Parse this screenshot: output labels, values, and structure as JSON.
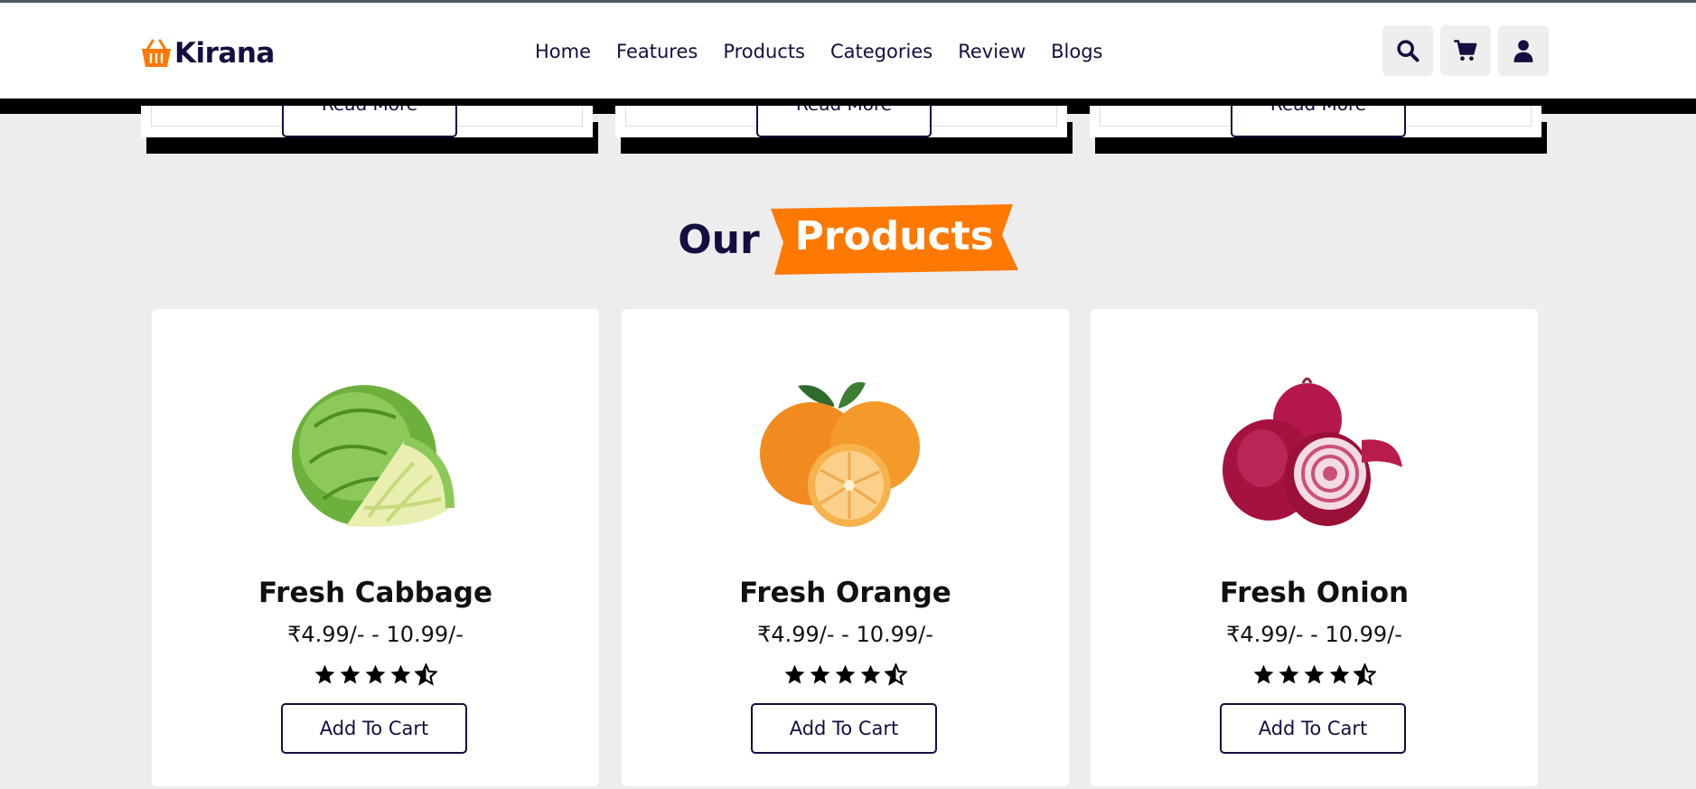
{
  "brand": {
    "name": "Kirana",
    "accent": "#ff7800",
    "dark": "#130f40"
  },
  "nav": {
    "items": [
      "Home",
      "Features",
      "Products",
      "Categories",
      "Review",
      "Blogs"
    ]
  },
  "header_icons": [
    "search-icon",
    "cart-icon",
    "user-icon"
  ],
  "blogs": {
    "read_more_label": "Read More"
  },
  "section": {
    "title_dark": "Our",
    "title_highlight": "Products"
  },
  "products": [
    {
      "name": "Fresh Cabbage",
      "price": "₹4.99/- - 10.99/-",
      "rating": 4.5,
      "button": "Add To Cart"
    },
    {
      "name": "Fresh Orange",
      "price": "₹4.99/- - 10.99/-",
      "rating": 4.5,
      "button": "Add To Cart"
    },
    {
      "name": "Fresh Onion",
      "price": "₹4.99/- - 10.99/-",
      "rating": 4.5,
      "button": "Add To Cart"
    }
  ]
}
